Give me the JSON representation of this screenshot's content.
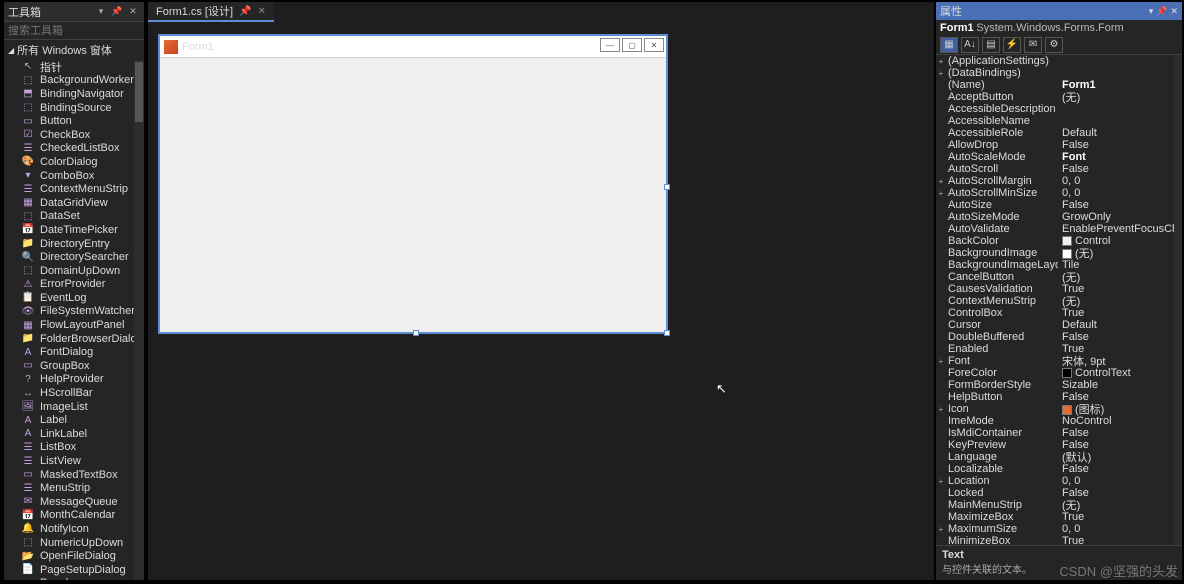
{
  "toolbox": {
    "title": "工具箱",
    "search_placeholder": "搜索工具箱",
    "category": "所有 Windows 窗体",
    "items": [
      "指针",
      "BackgroundWorker",
      "BindingNavigator",
      "BindingSource",
      "Button",
      "CheckBox",
      "CheckedListBox",
      "ColorDialog",
      "ComboBox",
      "ContextMenuStrip",
      "DataGridView",
      "DataSet",
      "DateTimePicker",
      "DirectoryEntry",
      "DirectorySearcher",
      "DomainUpDown",
      "ErrorProvider",
      "EventLog",
      "FileSystemWatcher",
      "FlowLayoutPanel",
      "FolderBrowserDialog",
      "FontDialog",
      "GroupBox",
      "HelpProvider",
      "HScrollBar",
      "ImageList",
      "Label",
      "LinkLabel",
      "ListBox",
      "ListView",
      "MaskedTextBox",
      "MenuStrip",
      "MessageQueue",
      "MonthCalendar",
      "NotifyIcon",
      "NumericUpDown",
      "OpenFileDialog",
      "PageSetupDialog",
      "Panel"
    ]
  },
  "tab": {
    "label": "Form1.cs [设计]"
  },
  "form": {
    "title": "Form1"
  },
  "properties": {
    "title": "属性",
    "object_name": "Form1",
    "object_type": "System.Windows.Forms.Form",
    "rows": [
      {
        "exp": "+",
        "k": "(ApplicationSettings)",
        "v": ""
      },
      {
        "exp": "+",
        "k": "(DataBindings)",
        "v": ""
      },
      {
        "exp": "",
        "k": "(Name)",
        "v": "Form1",
        "bold": true
      },
      {
        "exp": "",
        "k": "AcceptButton",
        "v": "(无)"
      },
      {
        "exp": "",
        "k": "AccessibleDescription",
        "v": ""
      },
      {
        "exp": "",
        "k": "AccessibleName",
        "v": ""
      },
      {
        "exp": "",
        "k": "AccessibleRole",
        "v": "Default"
      },
      {
        "exp": "",
        "k": "AllowDrop",
        "v": "False"
      },
      {
        "exp": "",
        "k": "AutoScaleMode",
        "v": "Font",
        "bold": true
      },
      {
        "exp": "",
        "k": "AutoScroll",
        "v": "False"
      },
      {
        "exp": "+",
        "k": "AutoScrollMargin",
        "v": "0, 0"
      },
      {
        "exp": "+",
        "k": "AutoScrollMinSize",
        "v": "0, 0"
      },
      {
        "exp": "",
        "k": "AutoSize",
        "v": "False"
      },
      {
        "exp": "",
        "k": "AutoSizeMode",
        "v": "GrowOnly"
      },
      {
        "exp": "",
        "k": "AutoValidate",
        "v": "EnablePreventFocusChange"
      },
      {
        "exp": "",
        "k": "BackColor",
        "v": "Control",
        "swatch": "#f0f0f0"
      },
      {
        "exp": "",
        "k": "BackgroundImage",
        "v": "(无)",
        "swatch": "#fff"
      },
      {
        "exp": "",
        "k": "BackgroundImageLayout",
        "v": "Tile"
      },
      {
        "exp": "",
        "k": "CancelButton",
        "v": "(无)"
      },
      {
        "exp": "",
        "k": "CausesValidation",
        "v": "True"
      },
      {
        "exp": "",
        "k": "ContextMenuStrip",
        "v": "(无)"
      },
      {
        "exp": "",
        "k": "ControlBox",
        "v": "True"
      },
      {
        "exp": "",
        "k": "Cursor",
        "v": "Default"
      },
      {
        "exp": "",
        "k": "DoubleBuffered",
        "v": "False"
      },
      {
        "exp": "",
        "k": "Enabled",
        "v": "True"
      },
      {
        "exp": "+",
        "k": "Font",
        "v": "宋体, 9pt"
      },
      {
        "exp": "",
        "k": "ForeColor",
        "v": "ControlText",
        "swatch": "#000"
      },
      {
        "exp": "",
        "k": "FormBorderStyle",
        "v": "Sizable"
      },
      {
        "exp": "",
        "k": "HelpButton",
        "v": "False"
      },
      {
        "exp": "+",
        "k": "Icon",
        "v": "(图标)",
        "swatch": "#e07030"
      },
      {
        "exp": "",
        "k": "ImeMode",
        "v": "NoControl"
      },
      {
        "exp": "",
        "k": "IsMdiContainer",
        "v": "False"
      },
      {
        "exp": "",
        "k": "KeyPreview",
        "v": "False"
      },
      {
        "exp": "",
        "k": "Language",
        "v": "(默认)"
      },
      {
        "exp": "",
        "k": "Localizable",
        "v": "False"
      },
      {
        "exp": "+",
        "k": "Location",
        "v": "0, 0"
      },
      {
        "exp": "",
        "k": "Locked",
        "v": "False"
      },
      {
        "exp": "",
        "k": "MainMenuStrip",
        "v": "(无)"
      },
      {
        "exp": "",
        "k": "MaximizeBox",
        "v": "True"
      },
      {
        "exp": "+",
        "k": "MaximumSize",
        "v": "0, 0"
      },
      {
        "exp": "",
        "k": "MinimizeBox",
        "v": "True"
      }
    ],
    "desc_key": "Text",
    "desc_text": "与控件关联的文本。"
  },
  "watermark": "CSDN @坚强的头发"
}
